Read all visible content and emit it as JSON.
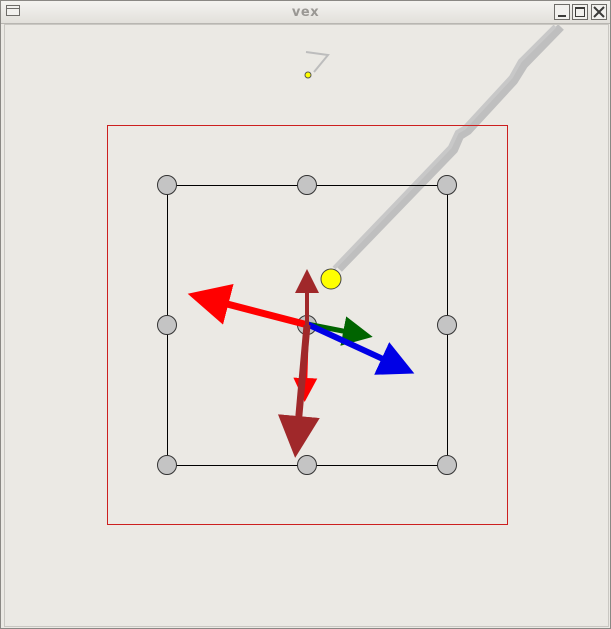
{
  "window": {
    "title": "vex",
    "buttons": {
      "menu": "window-menu",
      "minimize": "minimize",
      "maximize": "maximize",
      "close": "close"
    }
  },
  "scene": {
    "frame_color": "#cc1f1f",
    "grid_color": "#000000",
    "handle_fill": "#c4c4c4",
    "marker_fill": "#ffff00",
    "arrows": [
      {
        "name": "red-arrow",
        "color": "#ff0000"
      },
      {
        "name": "dark-red-arrow",
        "color": "#a0282a"
      },
      {
        "name": "blue-arrow",
        "color": "#0000e6"
      },
      {
        "name": "green-arrow",
        "color": "#006400"
      }
    ],
    "trail_color": "#c0c0c0"
  }
}
